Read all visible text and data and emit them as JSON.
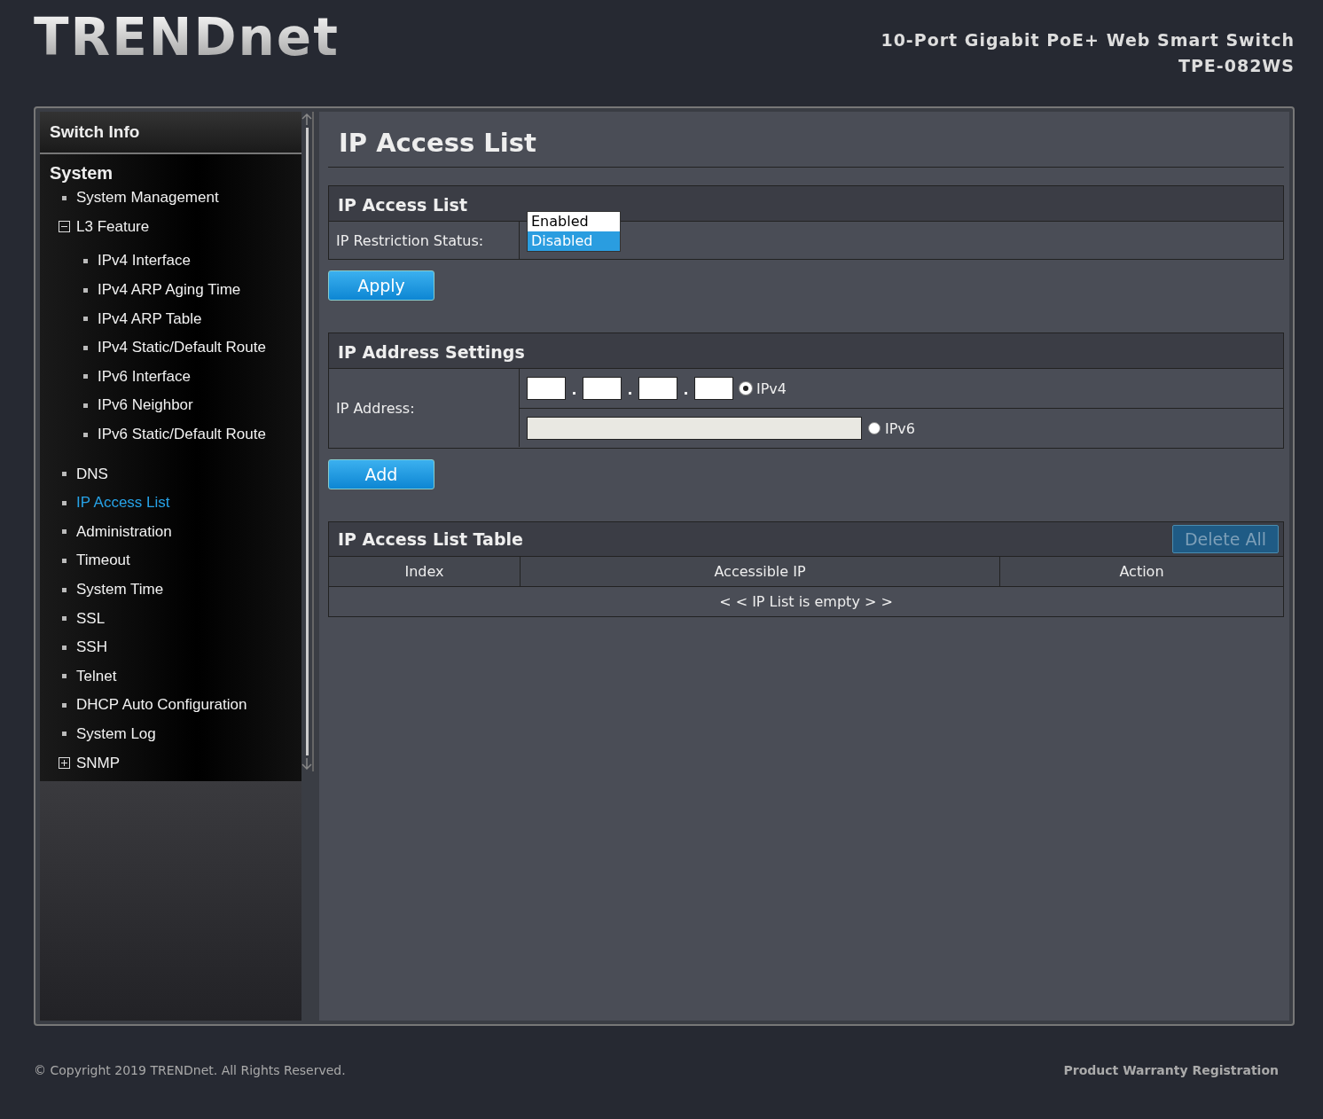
{
  "header": {
    "logo": "TRENDnet",
    "product": "10-Port Gigabit PoE+ Web Smart Switch",
    "model": "TPE-082WS"
  },
  "sidebar": {
    "top": "Switch Info",
    "section": "System",
    "items": [
      {
        "label": "System Management",
        "selected": false
      },
      {
        "label": "L3 Feature",
        "selected": false,
        "expanded": true,
        "children": [
          {
            "label": "IPv4 Interface",
            "selected": false
          },
          {
            "label": "IPv4 ARP Aging Time",
            "selected": false
          },
          {
            "label": "IPv4 ARP Table",
            "selected": false
          },
          {
            "label": "IPv4 Static/Default Route",
            "selected": false
          },
          {
            "label": "IPv6 Interface",
            "selected": false
          },
          {
            "label": "IPv6 Neighbor",
            "selected": false
          },
          {
            "label": "IPv6 Static/Default Route",
            "selected": false
          }
        ]
      },
      {
        "label": "DNS",
        "selected": false
      },
      {
        "label": "IP Access List",
        "selected": true
      },
      {
        "label": "Administration",
        "selected": false
      },
      {
        "label": "Timeout",
        "selected": false
      },
      {
        "label": "System Time",
        "selected": false
      },
      {
        "label": "SSL",
        "selected": false
      },
      {
        "label": "SSH",
        "selected": false
      },
      {
        "label": "Telnet",
        "selected": false
      },
      {
        "label": "DHCP Auto Configuration",
        "selected": false
      },
      {
        "label": "System Log",
        "selected": false
      },
      {
        "label": "SNMP",
        "selected": false,
        "expanded": false
      }
    ]
  },
  "page_title": "IP Access List",
  "access_list": {
    "title": "IP Access List",
    "label": "IP Restriction Status:",
    "options": [
      {
        "label": "Enabled",
        "selected": false
      },
      {
        "label": "Disabled",
        "selected": true
      }
    ],
    "button": "Apply"
  },
  "address_settings": {
    "title": "IP Address Settings",
    "label": "IP Address:",
    "ipv4_label": "IPv4",
    "ipv4_selected": true,
    "ipv6_label": "IPv6",
    "ipv6_selected": false,
    "button": "Add"
  },
  "table": {
    "title": "IP Access List Table",
    "delete_all": {
      "label": "Delete All",
      "disabled": true
    },
    "columns": [
      "Index",
      "Accessible IP",
      "Action"
    ],
    "empty": "< < IP List is empty > >"
  },
  "footer": {
    "copyright": "© Copyright 2019 TRENDnet. All Rights Reserved.",
    "link": "Product Warranty Registration"
  }
}
